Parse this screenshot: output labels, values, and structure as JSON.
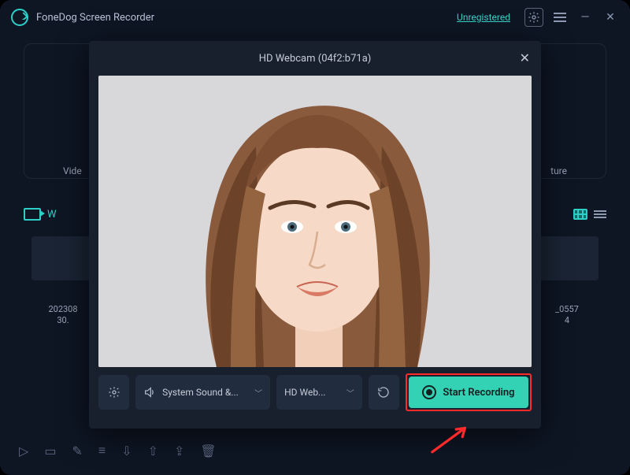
{
  "app": {
    "title": "FoneDog Screen Recorder",
    "status_link": "Unregistered"
  },
  "bg": {
    "mode_left_label": "Vide",
    "mode_right_label": "ture",
    "row_label": "W",
    "thumb_left_name": "202308",
    "thumb_left_ext": "30.",
    "thumb_right_name": "_0557",
    "thumb_right_ext": "4"
  },
  "modal": {
    "title": "HD Webcam (04f2:b71a)",
    "audio_dropdown": "System Sound &...",
    "camera_dropdown": "HD Web...",
    "start_button": "Start Recording"
  }
}
